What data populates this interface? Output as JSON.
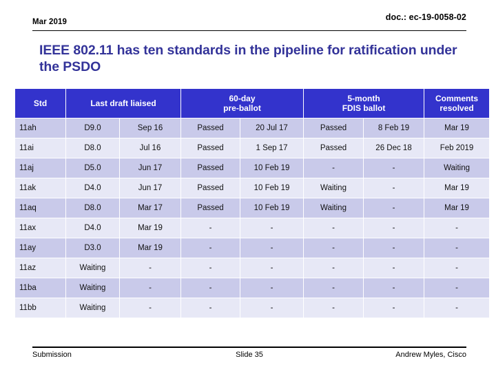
{
  "header": {
    "date": "Mar 2019",
    "doc": "doc.: ec-19-0058-02"
  },
  "title": "IEEE 802.11 has ten standards in the pipeline for ratification under the PSDO",
  "table": {
    "headers": {
      "std": "Std",
      "last_draft_liaised": "Last draft liaised",
      "pre_ballot": "60-day\npre-ballot",
      "pre_ballot_line1": "60-day",
      "pre_ballot_line2": "pre-ballot",
      "fdis_ballot_line1": "5-month",
      "fdis_ballot_line2": "FDIS ballot",
      "comments_line1": "Comments",
      "comments_line2": "resolved"
    },
    "columns": [
      "Std",
      "Last draft liaised (version)",
      "Last draft liaised (date)",
      "60-day pre-ballot (result)",
      "60-day pre-ballot (date)",
      "5-month FDIS ballot (result)",
      "5-month FDIS ballot (date)",
      "Comments resolved"
    ],
    "rows": [
      {
        "std": "11ah",
        "draft_version": "D9.0",
        "draft_date": "Sep 16",
        "preballot_result": "Passed",
        "preballot_result_state": "passed",
        "preballot_date": "20 Jul 17",
        "fdis_result": "Passed",
        "fdis_result_state": "passed",
        "fdis_date": "8 Feb 19",
        "comments": "Mar 19",
        "comments_state": "plain"
      },
      {
        "std": "11ai",
        "draft_version": "D8.0",
        "draft_date": "Jul 16",
        "preballot_result": "Passed",
        "preballot_result_state": "passed",
        "preballot_date": "1 Sep 17",
        "fdis_result": "Passed",
        "fdis_result_state": "passed",
        "fdis_date": "26 Dec 18",
        "comments": "Feb 2019",
        "comments_state": "plain"
      },
      {
        "std": "11aj",
        "draft_version": "D5.0",
        "draft_date": "Jun 17",
        "preballot_result": "Passed",
        "preballot_result_state": "passed",
        "preballot_date": "10 Feb 19",
        "fdis_result": "-",
        "fdis_result_state": "dash",
        "fdis_date": "-",
        "comments": "Waiting",
        "comments_state": "waiting"
      },
      {
        "std": "11ak",
        "draft_version": "D4.0",
        "draft_date": "Jun 17",
        "preballot_result": "Passed",
        "preballot_result_state": "passed",
        "preballot_date": "10 Feb 19",
        "fdis_result": "Waiting",
        "fdis_result_state": "waiting",
        "fdis_date": "-",
        "comments": "Mar 19",
        "comments_state": "plain"
      },
      {
        "std": "11aq",
        "draft_version": "D8.0",
        "draft_date": "Mar 17",
        "preballot_result": "Passed",
        "preballot_result_state": "passed",
        "preballot_date": "10 Feb 19",
        "fdis_result": "Waiting",
        "fdis_result_state": "waiting",
        "fdis_date": "-",
        "comments": "Mar 19",
        "comments_state": "plain"
      },
      {
        "std": "11ax",
        "draft_version": "D4.0",
        "draft_date": "Mar 19",
        "preballot_result": "-",
        "preballot_result_state": "dash",
        "preballot_date": "-",
        "fdis_result": "-",
        "fdis_result_state": "dash",
        "fdis_date": "-",
        "comments": "-",
        "comments_state": "dash"
      },
      {
        "std": "11ay",
        "draft_version": "D3.0",
        "draft_date": "Mar 19",
        "preballot_result": "-",
        "preballot_result_state": "dash",
        "preballot_date": "-",
        "fdis_result": "-",
        "fdis_result_state": "dash",
        "fdis_date": "-",
        "comments": "-",
        "comments_state": "dash"
      },
      {
        "std": "11az",
        "draft_version": "Waiting",
        "draft_version_state": "waiting",
        "draft_date": "-",
        "preballot_result": "-",
        "preballot_result_state": "dash",
        "preballot_date": "-",
        "fdis_result": "-",
        "fdis_result_state": "dash",
        "fdis_date": "-",
        "comments": "-",
        "comments_state": "dash"
      },
      {
        "std": "11ba",
        "draft_version": "Waiting",
        "draft_version_state": "waiting",
        "draft_date": "-",
        "preballot_result": "-",
        "preballot_result_state": "dash",
        "preballot_date": "-",
        "fdis_result": "-",
        "fdis_result_state": "dash",
        "fdis_date": "-",
        "comments": "-",
        "comments_state": "dash"
      },
      {
        "std": "11bb",
        "draft_version": "Waiting",
        "draft_version_state": "waiting",
        "draft_date": "-",
        "preballot_result": "-",
        "preballot_result_state": "dash",
        "preballot_date": "-",
        "fdis_result": "-",
        "fdis_result_state": "dash",
        "fdis_date": "-",
        "comments": "-",
        "comments_state": "dash"
      }
    ]
  },
  "footer": {
    "left": "Submission",
    "center": "Slide 35",
    "right": "Andrew Myles, Cisco"
  },
  "colors": {
    "header_blue": "#3333CC",
    "title_indigo": "#333399",
    "row_odd": "#c9caea",
    "row_even": "#e7e8f6",
    "passed_green": "#4f9f7f",
    "waiting_blue": "#4a4ac8"
  }
}
